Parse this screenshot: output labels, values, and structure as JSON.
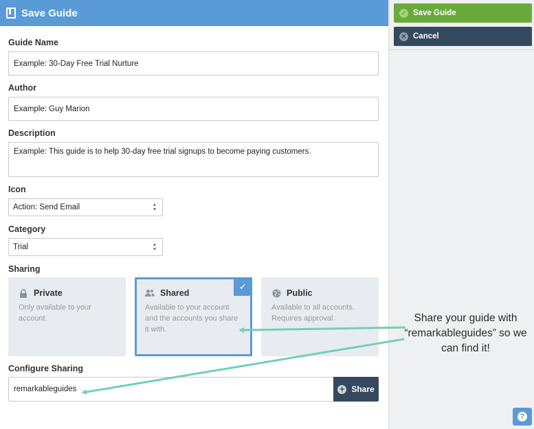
{
  "header": {
    "title": "Save Guide"
  },
  "form": {
    "guide_name": {
      "label": "Guide Name",
      "value": "Example: 30-Day Free Trial Nurture"
    },
    "author": {
      "label": "Author",
      "value": "Example: Guy Marion"
    },
    "description": {
      "label": "Description",
      "value": "Example: This guide is to help 30-day free trial signups to become paying customers."
    },
    "icon": {
      "label": "Icon",
      "value": "Action: Send Email"
    },
    "category": {
      "label": "Category",
      "value": "Trial"
    },
    "sharing": {
      "label": "Sharing",
      "options": [
        {
          "title": "Private",
          "desc": "Only available to your account.",
          "icon": "lock-icon",
          "selected": false
        },
        {
          "title": "Shared",
          "desc": "Available to your account and the accounts you share it with.",
          "icon": "users-icon",
          "selected": true
        },
        {
          "title": "Public",
          "desc": "Available to all accounts. Requires approval.",
          "icon": "globe-icon",
          "selected": false
        }
      ]
    },
    "configure_sharing": {
      "label": "Configure Sharing",
      "value": "remarkableguides",
      "button": "Share"
    }
  },
  "actions": {
    "save": "Save Guide",
    "cancel": "Cancel"
  },
  "annotation": {
    "text": "Share your guide with “remarkableguides” so we can find it!"
  },
  "colors": {
    "header": "#5a9ad6",
    "save": "#6aaa3a",
    "cancel": "#34485e",
    "arrow": "#6fd0b8"
  }
}
